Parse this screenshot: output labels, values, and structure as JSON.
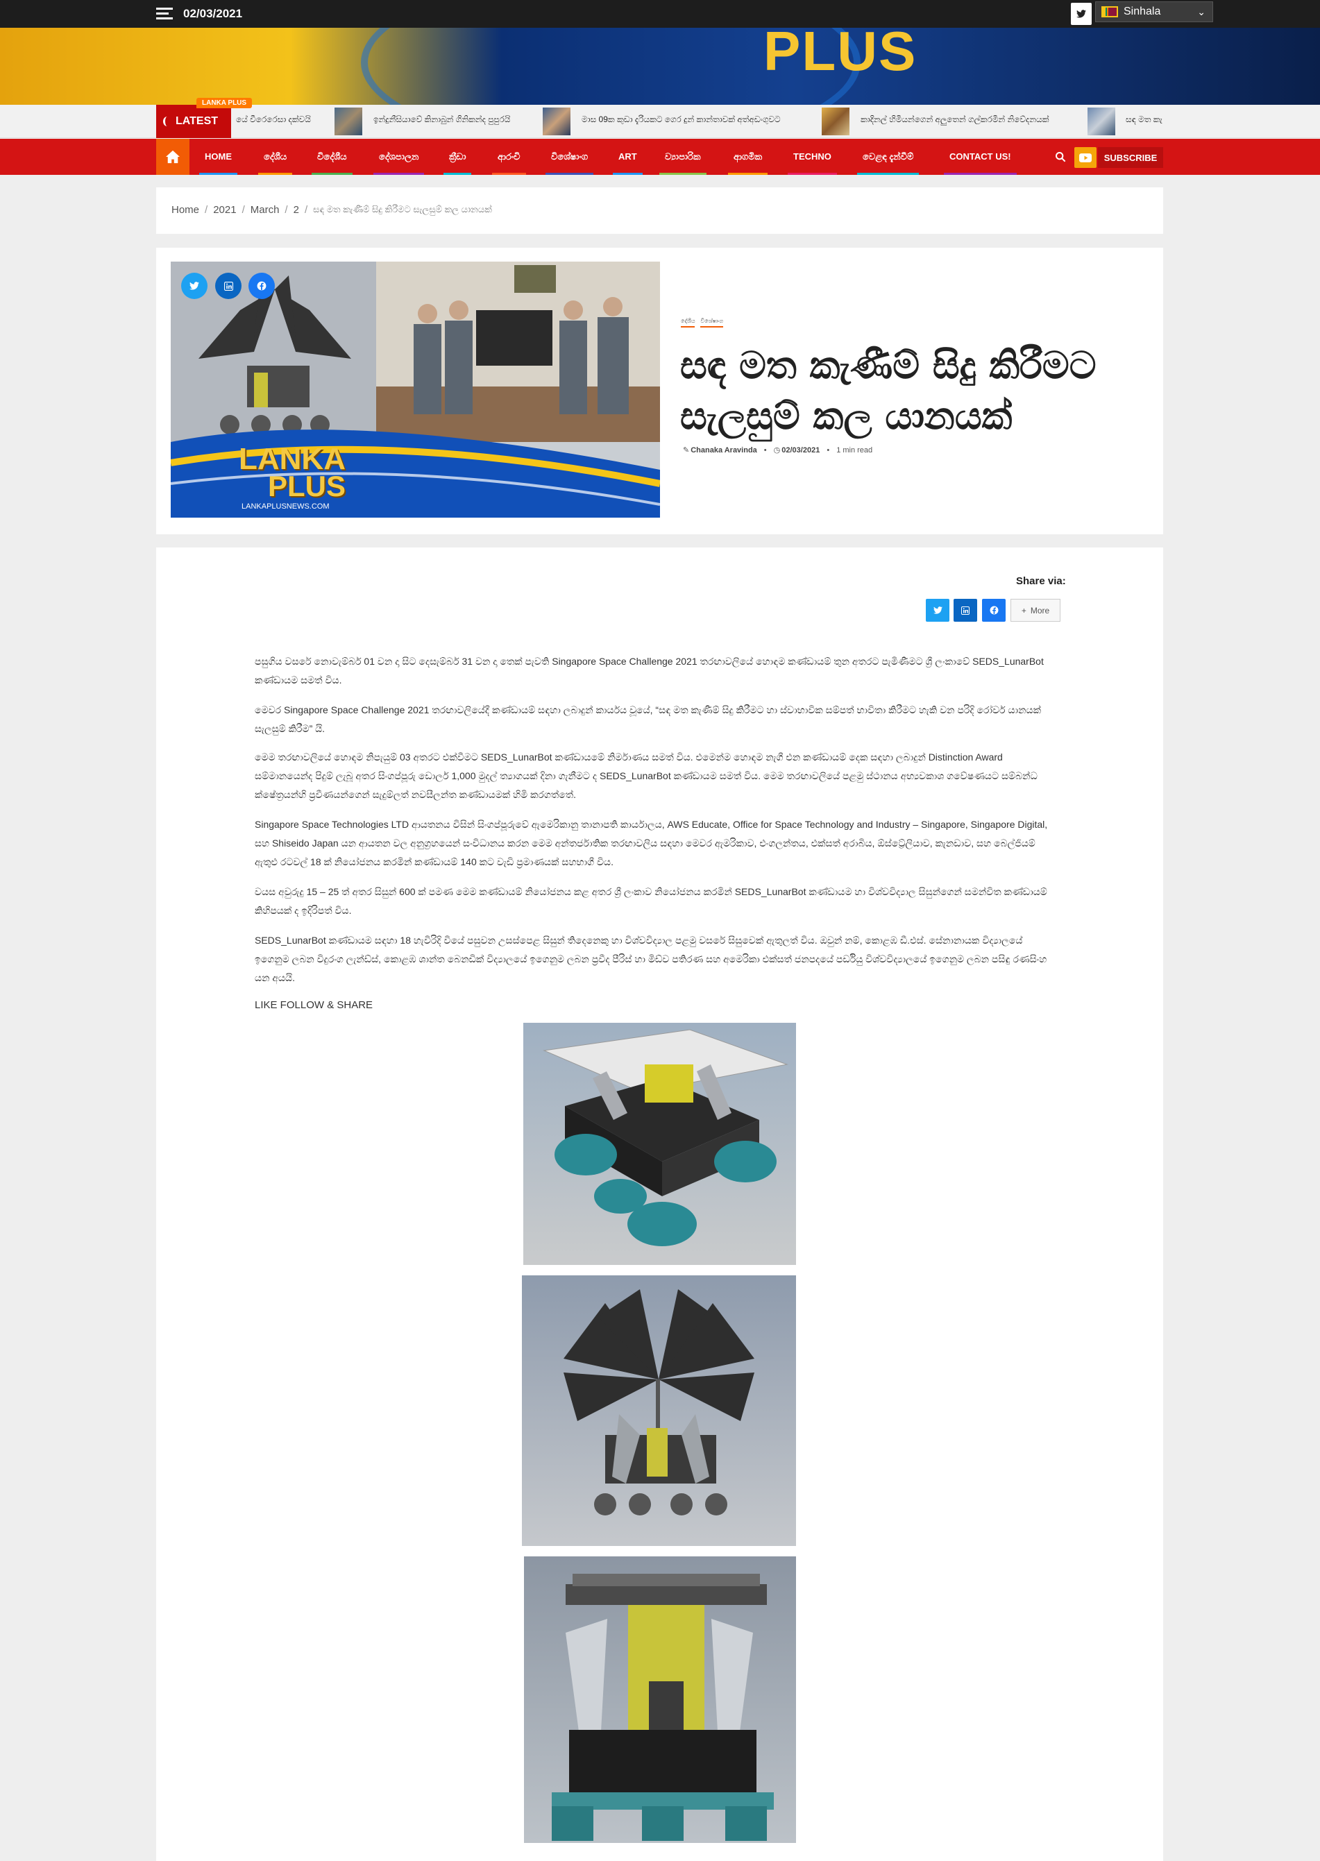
{
  "topbar": {
    "date": "02/03/2021",
    "language": "Sinhala"
  },
  "banner": {
    "logo_text": "PLUS"
  },
  "ticker": {
    "latest_label": "LATEST",
    "tag": "LANKA PLUS",
    "items": [
      "යේ වීරෙරෙසා දක්වයි",
      "ඉන්දුනීසියාවේ කිනාබුන් ගිනිකන්ද පුපුරයි",
      "මාස 09ක කුඩා දැරියකට ගෙර දුන් කාන්තාවක් අත්අඩංගුවට",
      "කාදිනල් හිමියන්ගෙන් අලුතෙන් ගල්කරමින් නිවේදනයක්",
      "සඳ මත කැ"
    ]
  },
  "nav": {
    "items": [
      "HOME",
      "දේශීය",
      "විදේශීය",
      "දේශපාලන",
      "ක්‍රීඩා",
      "ආරංචි",
      "විශේෂාංග",
      "ART",
      "ව්‍යාපාරික",
      "ආගමික",
      "TECHNO",
      "වෙළඳ දැන්වීම්",
      "CONTACT US!"
    ],
    "subscribe": "SUBSCRIBE"
  },
  "breadcrumb": [
    "Home",
    "2021",
    "March",
    "2",
    "සඳ මත කැණීම් සිදු කිරීමට සැලසුම් කල යානයක්"
  ],
  "article": {
    "categories": [
      "දේශීය",
      "විශේෂාංග"
    ],
    "title": "සඳ මත කැණීම් සිදු කිරීමට සැලසුම් කල යානයක්",
    "author": "Chanaka Aravinda",
    "date": "02/03/2021",
    "read_time": "1 min read",
    "hero_logo_top": "LANKA",
    "hero_logo_bottom": "PLUS",
    "hero_site": "LANKAPLUSNEWS.COM",
    "share_label": "Share via:",
    "more_label": "More",
    "paragraphs": [
      "පසුගිය වසරේ නොවැම්බර් 01 වන දා සිට දෙසැම්බර් 31 වන දා තෙක් පැවති Singapore Space Challenge 2021 තරඟාවලියේ හොඳම කණ්ඩායම් තුන අතරට පැමිණීමට ශ්‍රී ලංකාවේ SEDS_LunarBot කණ්ඩායම සමත් විය.",
      "මෙවර Singapore Space Challenge 2021 තරඟාවලියේදී කණ්ඩායම් සඳහා ලබාදුන් කාර්යය වූයේ, “සඳ මත කැණීම් සිදු කිරීමට හා ස්වාභාවික සම්පත් භාවිතා කිරීමට හැකි වන පරිදි රෝවර් යානයක් සැලසුම් කිරීම” යි.",
      "මෙම තරඟාවලියේ හොඳම නිපැයුම් 03 අතරට එක්වීමට SEDS_LunarBot කණ්ඩායමේ නිර්මාණය සමත් විය. එමෙන්ම හොඳම නැගී එන කණ්ඩායම් දෙක සඳහා ලබාදුන් Distinction Award සම්මානයෙන්ද පිදුම් ලැබූ අතර සිංගප්පූරු ඩොලර් 1,000 මුදල් ත්‍යාගයක් දිනා ගැනීමට ද SEDS_LunarBot කණ්ඩායම සමත් විය. මෙම තරඟාවලියේ පළමු ස්ථානය අභ්‍යවකාශ ගවේෂණයට සම්බන්ධ ක්ෂේත්‍රයන්හි ප්‍රවීණයන්ගෙන් සැදුම්ලත් නවසීලන්ත කණ්ඩායමක් හිමි කරගත්තේ.",
      "Singapore Space Technologies LTD ආයතනය විසින් සිංගප්පූරුවේ ඇමෙරිකානු තානාපති කාර්යාලය, AWS Educate, Office for Space Technology and Industry – Singapore, Singapore Digital, සහ Shiseido Japan යන ආයතන වල අනුග්‍රහයෙන් සංවිධානය කරන මෙම අන්තර්ජාතික තරඟාවලිය සඳහා මෙවර ඇමරිකාව, එංගලන්තය, එක්සත් අරාබිය, ඕස්ට්‍රේලියාව, කැනඩාව, සහ බෙල්ජියම් ඇතුළු රටවල් 18 ක් නියෝජනය කරමින් කණ්ඩායම් 140 කට වැඩි ප්‍රමාණයක් සහභාගී විය.",
      "වයස අවුරුදු 15 – 25 ත් අතර සිසුන් 600 ක් පමණ මෙම කණ්ඩායම් නියෝජනය කළ අතර ශ්‍රී ලංකාව නියෝජනය කරමින් SEDS_LunarBot කණ්ඩායම හා විශ්වවිද්‍යාල සිසුන්ගෙන් සමන්විත කණ්ඩායම් කිහිපයක් ද ඉදිරිපත් විය.",
      "SEDS_LunarBot කණ්ඩායම සඳහා 18 හැවිරිදි වියේ පසුවන උසස්පෙළ සිසුන් තිදෙනෙකු හා විශ්වවිද්‍යාල පළමු වසරේ සිසුවෙක් ඇතුලත් විය. ඔවුන් නම්, කොළඹ ඩී.එස්. සේනානායක විද්‍යාලයේ ඉගෙනුම ලබන විදුරංග ලැන්ඩ්ස්, කොළඹ ශාන්ත බෙනඩික් විද්‍යාලයේ ඉගෙනුම ලබන ප්‍රවීද පීරිස් හා මිඩ්ව පතිරණ සහ අමෙරිකා එක්සත් ජනපදයේ පර්ඩියු විශ්වවිද්‍යාලයේ ඉගෙනුම ලබන පසිඳු රණසිංහ යන අයයි."
    ],
    "follow_share": "LIKE FOLLOW & SHARE"
  },
  "colors": {
    "nav_red": "#d41414",
    "accent_orange": "#f25c05",
    "twitter": "#1da1f2",
    "linkedin": "#0a66c2",
    "facebook": "#1877f2"
  }
}
